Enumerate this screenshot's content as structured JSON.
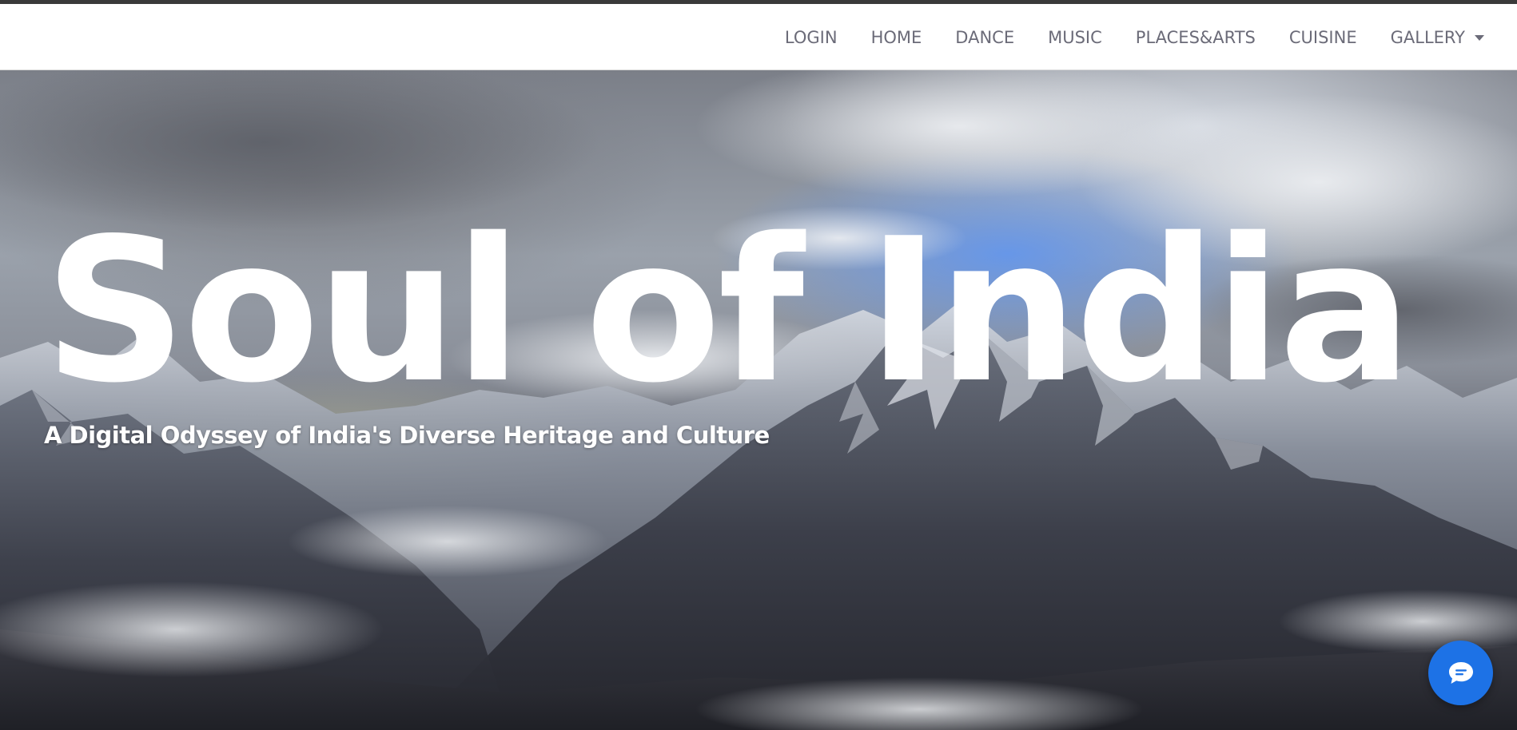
{
  "navbar": {
    "items": [
      {
        "label": "LOGIN"
      },
      {
        "label": "HOME"
      },
      {
        "label": "DANCE"
      },
      {
        "label": "MUSIC"
      },
      {
        "label": "PLACES&ARTS"
      },
      {
        "label": "CUISINE"
      },
      {
        "label": "GALLERY",
        "has_dropdown": true
      }
    ]
  },
  "hero": {
    "title": "Soul of India",
    "subtitle": "A Digital Odyssey of India's Diverse Heritage and Culture",
    "background": "mountain-landscape-image"
  },
  "chat": {
    "icon": "chat-bubble-icon",
    "color": "#1d72e6"
  }
}
